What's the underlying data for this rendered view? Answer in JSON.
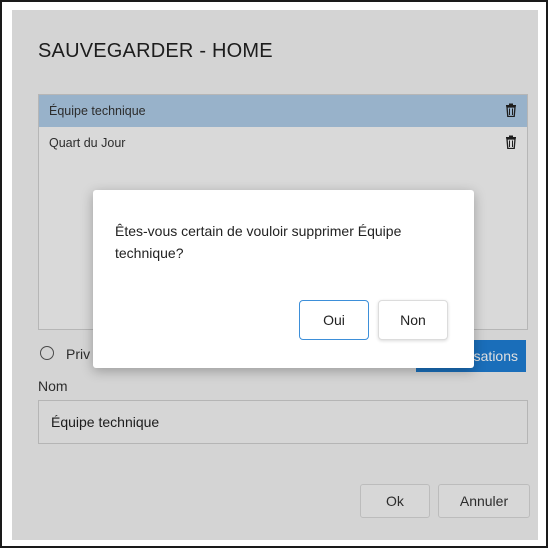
{
  "dialog": {
    "title": "SAUVEGARDER - HOME",
    "list": {
      "items": [
        {
          "label": "Équipe technique",
          "selected": true,
          "icon": "trash-icon"
        },
        {
          "label": "Quart du Jour",
          "selected": false,
          "icon": "trash-icon"
        }
      ]
    },
    "radio_label": "Priv",
    "blue_button_label": "sations",
    "nom_label": "Nom",
    "nom_value": "Équipe technique",
    "ok_label": "Ok",
    "cancel_label": "Annuler"
  },
  "confirm": {
    "message": "Êtes-vous certain de vouloir supprimer Équipe technique?",
    "yes_label": "Oui",
    "no_label": "Non"
  },
  "colors": {
    "selected_row": "#aecbe6",
    "accent_button": "#1e7ed4",
    "focus_border": "#3d8fd9"
  }
}
